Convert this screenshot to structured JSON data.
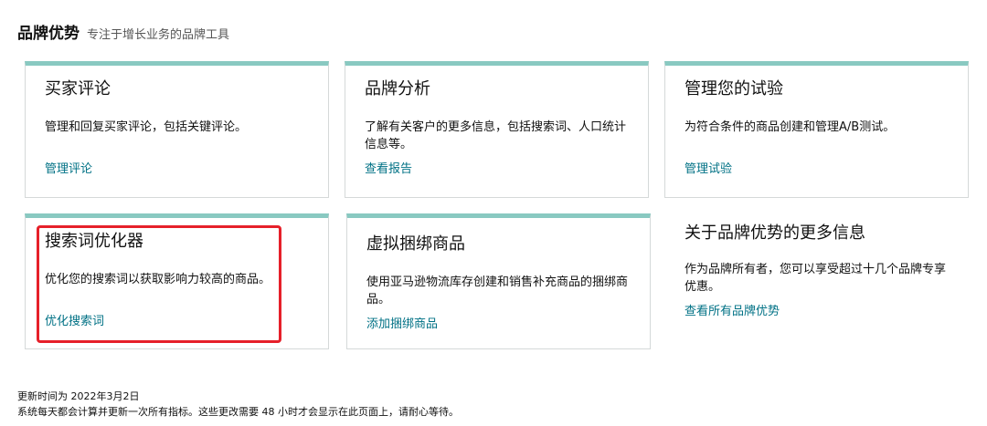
{
  "header": {
    "title": "品牌优势",
    "subtitle": "专注于增长业务的品牌工具"
  },
  "cards": [
    {
      "title": "买家评论",
      "desc": "管理和回复买家评论，包括关键评论。",
      "link": "管理评论"
    },
    {
      "title": "品牌分析",
      "desc": "了解有关客户的更多信息，包括搜索词、人口统计信息等。",
      "link": "查看报告"
    },
    {
      "title": "管理您的试验",
      "desc": "为符合条件的商品创建和管理A/B测试。",
      "link": "管理试验"
    },
    {
      "title": "搜索词优化器",
      "desc": "优化您的搜索词以获取影响力较高的商品。",
      "link": "优化搜索词"
    },
    {
      "title": "虚拟捆绑商品",
      "desc": "使用亚马逊物流库存创建和销售补充商品的捆绑商品。",
      "link": "添加捆绑商品"
    },
    {
      "title": "关于品牌优势的更多信息",
      "desc": "作为品牌所有者，您可以享受超过十几个品牌专享优惠。",
      "link": "查看所有品牌优势"
    }
  ],
  "footer": {
    "updated": "更新时间为 2022年3月2日",
    "note": "系统每天都会计算并更新一次所有指标。这些更改需要 48 小时才会显示在此页面上，请耐心等待。"
  },
  "colors": {
    "card_accent": "#89c9c1",
    "link": "#007185",
    "highlight": "#e6202a"
  }
}
